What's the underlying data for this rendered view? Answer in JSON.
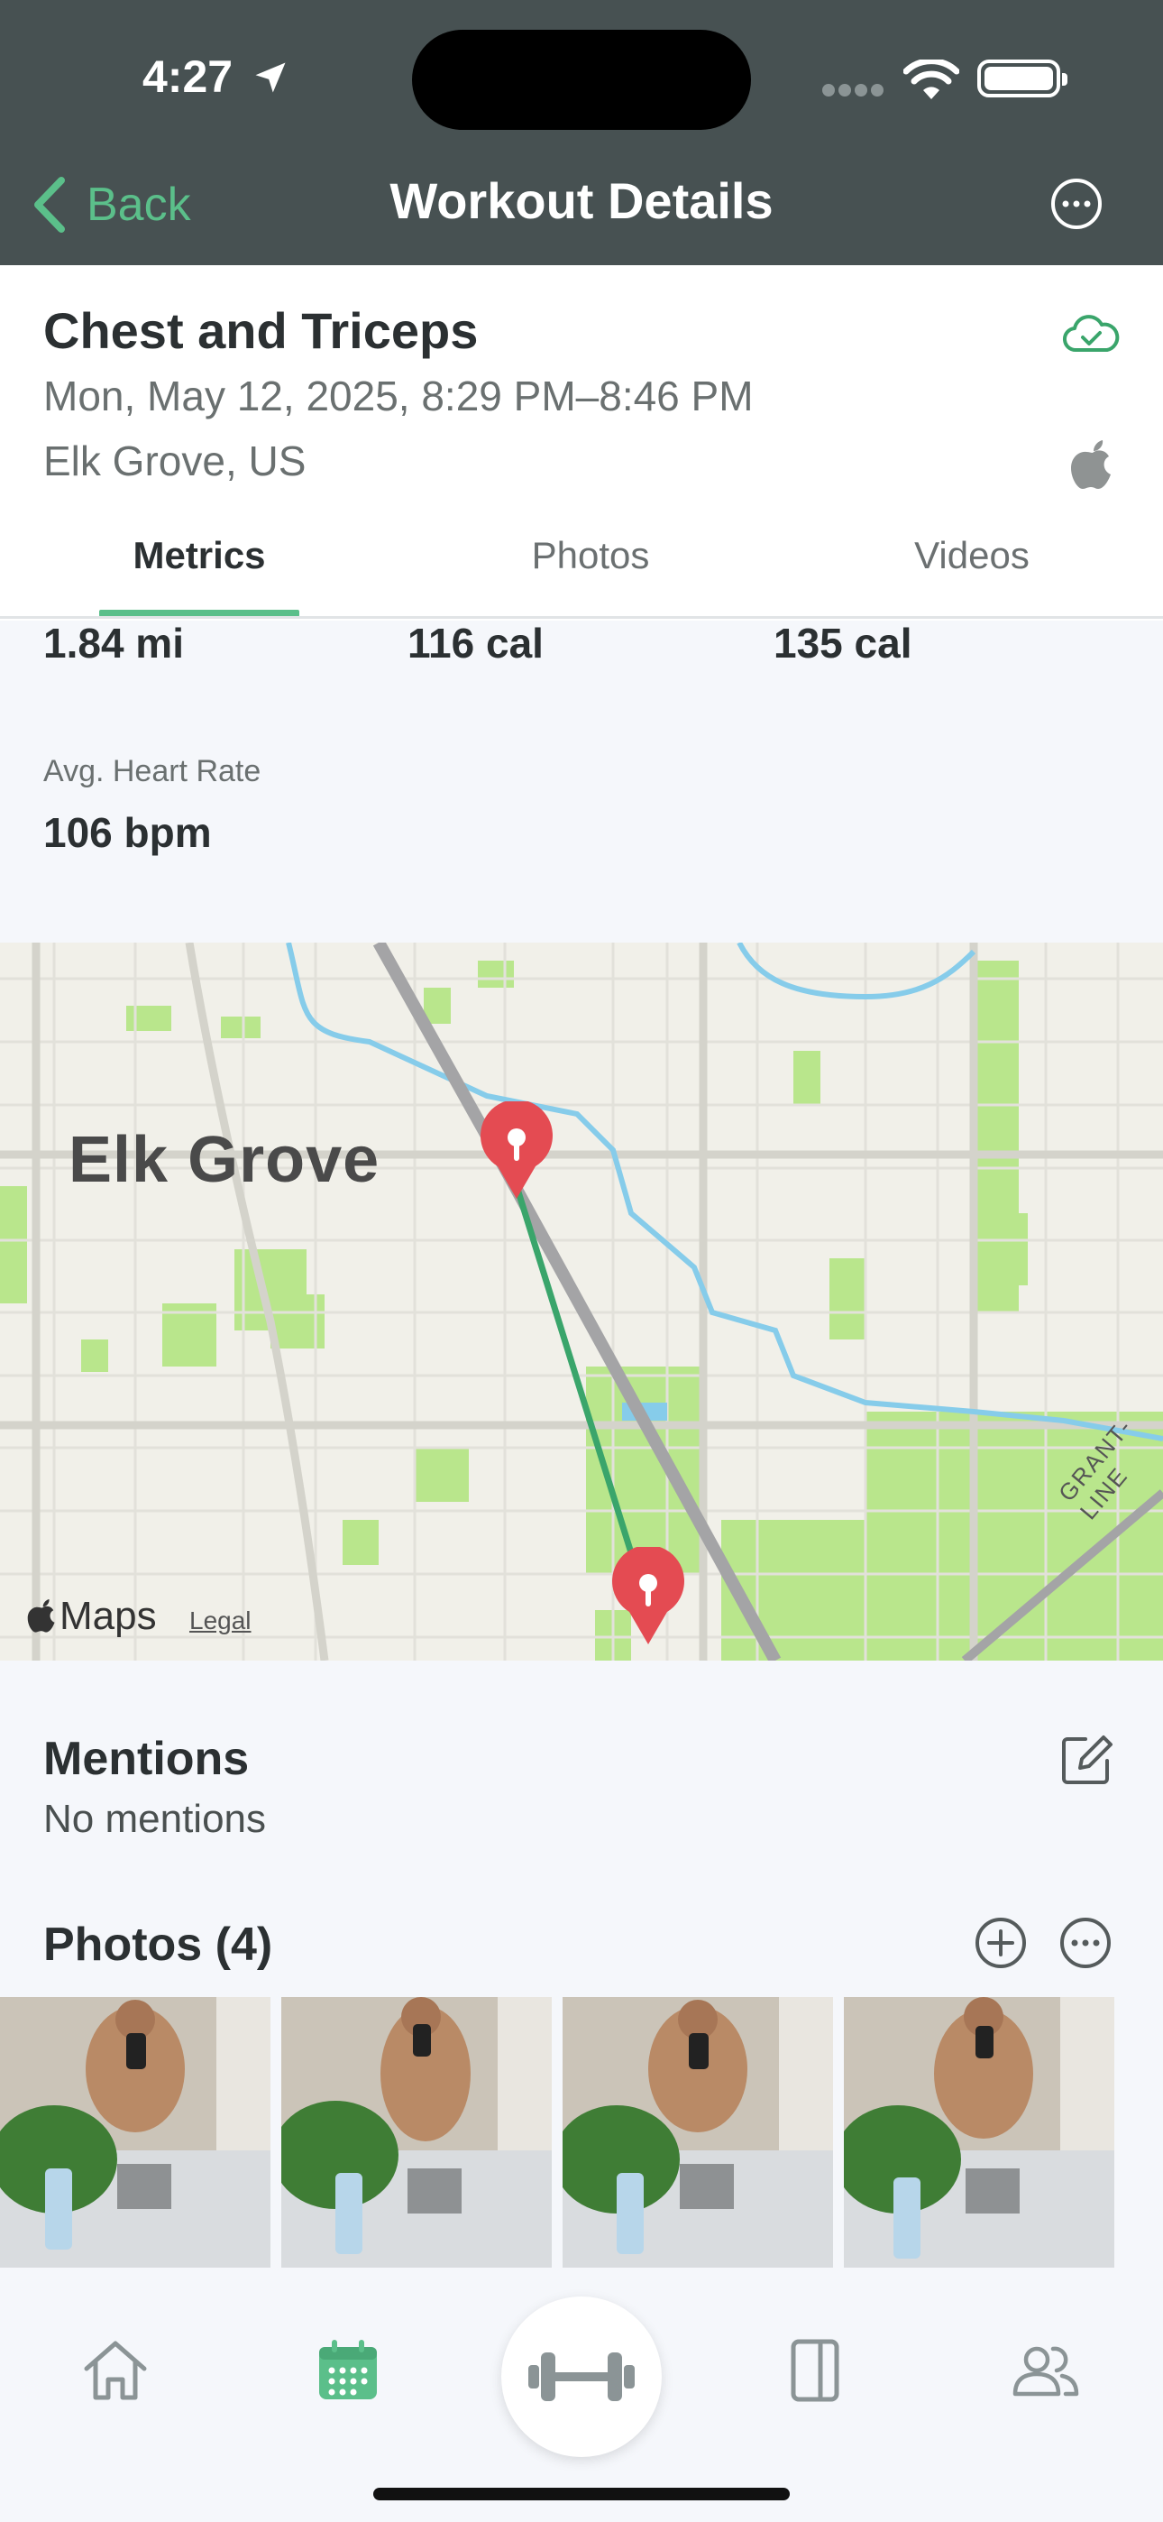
{
  "status_bar": {
    "time": "4:27"
  },
  "nav": {
    "back_label": "Back",
    "title": "Workout Details"
  },
  "workout": {
    "name": "Chest and Triceps",
    "datetime": "Mon, May 12, 2025, 8:29 PM–8:46 PM",
    "location": "Elk Grove, US"
  },
  "tabs": [
    {
      "label": "Metrics",
      "active": true
    },
    {
      "label": "Photos",
      "active": false
    },
    {
      "label": "Videos",
      "active": false
    }
  ],
  "metrics": {
    "row_values": [
      "1.84 mi",
      "116 cal",
      "135 cal"
    ],
    "heart_rate_label": "Avg. Heart Rate",
    "heart_rate_value": "106 bpm"
  },
  "map": {
    "city_label": "Elk Grove",
    "road_label": "GRANT-LINE",
    "provider": "Maps",
    "legal": "Legal"
  },
  "mentions": {
    "title": "Mentions",
    "subtitle": "No mentions"
  },
  "photos": {
    "title": "Photos (4)",
    "count": 4
  },
  "tabbar_items": [
    "home-icon",
    "calendar-icon",
    "dumbbell-icon",
    "book-icon",
    "people-icon"
  ],
  "colors": {
    "accent_green": "#5bbf8a",
    "nav_background": "#475152",
    "pin_red": "#e44b52",
    "water_blue": "#86ccea",
    "park_green": "#b7e58a"
  }
}
